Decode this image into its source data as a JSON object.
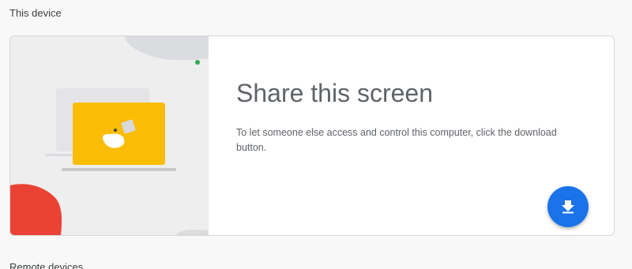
{
  "section": {
    "label": "This device"
  },
  "share_card": {
    "title": "Share this screen",
    "description": "To let someone else access and control this computer, click the download button.",
    "download_icon": "download-icon",
    "illustration_icon": "laptop-illustration",
    "colors": {
      "accent_blue": "#1a73e8",
      "laptop_yellow": "#fbbc04",
      "blob_red": "#ea4335",
      "dot_green": "#34a853"
    }
  },
  "next_section": {
    "label": "Remote devices"
  }
}
